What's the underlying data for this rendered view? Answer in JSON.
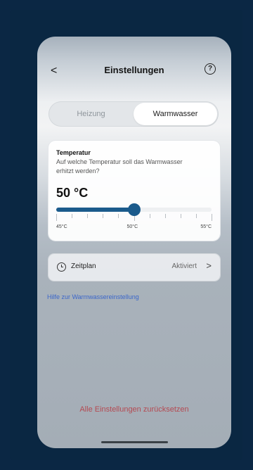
{
  "header": {
    "back_symbol": "<",
    "title": "Einstellungen",
    "help_symbol": "?"
  },
  "tabs": [
    {
      "label": "Heizung",
      "selected": false
    },
    {
      "label": "Warmwasser",
      "selected": true
    }
  ],
  "temperature": {
    "title": "Temperatur",
    "description": "Auf welche Temperatur soll das Warmwasser erhitzt werden?",
    "value_label": "50 °C",
    "min": 45,
    "max": 55,
    "value": 50,
    "tick_labels": [
      "45°C",
      "50°C",
      "55°C"
    ]
  },
  "schedule": {
    "label": "Zeitplan",
    "status": "Aktiviert",
    "chevron": ">"
  },
  "help_link": "Hilfe zur Warmwassereinstellung",
  "reset_label": "Alle Einstellungen zurücksetzen",
  "colors": {
    "accent": "#1b5b8c",
    "link": "#3b67c9",
    "danger": "#b44a52"
  },
  "icons": {
    "back": "chevron-left-icon",
    "help": "question-circle-icon",
    "schedule": "clock-icon",
    "schedule_chevron": "chevron-right-icon"
  }
}
